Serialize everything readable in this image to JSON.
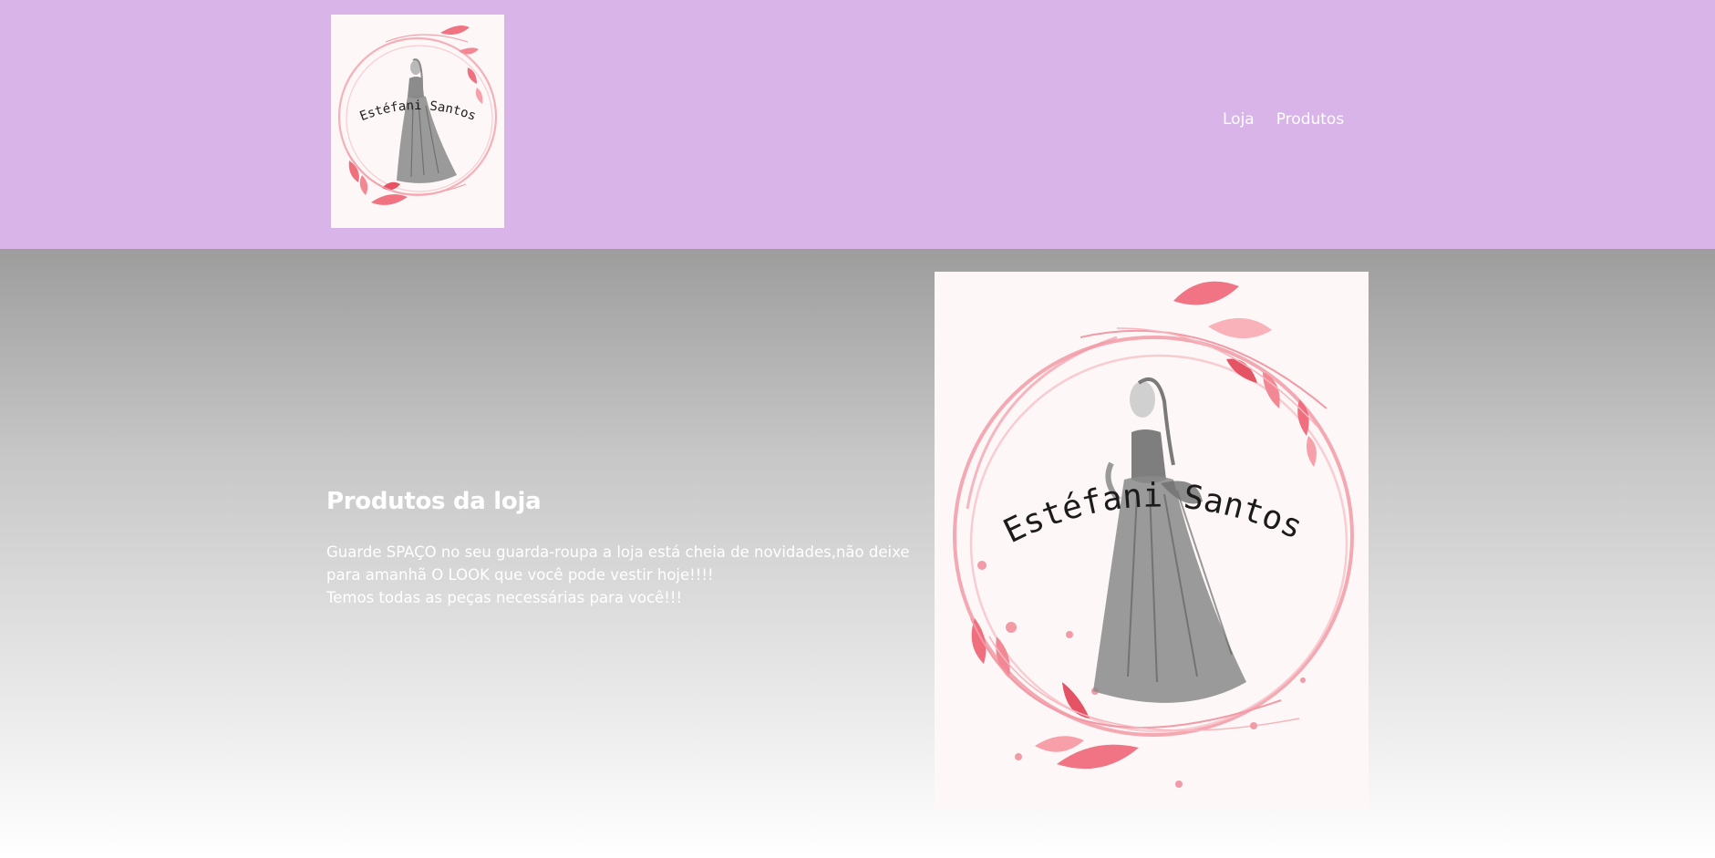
{
  "header": {
    "logo_text": "Estéfani Santos",
    "nav": [
      {
        "label": "Loja"
      },
      {
        "label": "Produtos"
      }
    ]
  },
  "hero": {
    "title": "Produtos da loja",
    "paragraph_line1": "Guarde SPAÇO no seu guarda-roupa a loja está cheia de novidades,não deixe para amanhã O LOOK que você pode vestir hoje!!!!",
    "paragraph_line2": "Temos todas as peças necessárias para você!!!",
    "image_text": "Estéfani Santos"
  },
  "colors": {
    "header_bg": "#d8b4e8",
    "accent_pink": "#ef6f7f",
    "text_white": "#ffffff"
  }
}
